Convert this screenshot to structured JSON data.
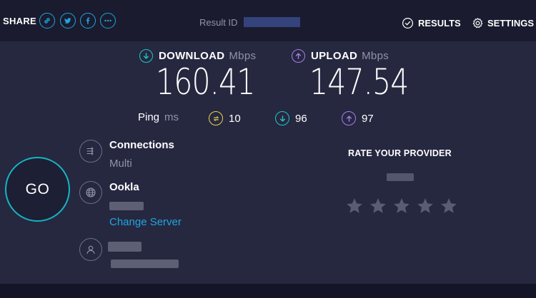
{
  "header": {
    "share_label": "SHARE",
    "share_buttons": [
      {
        "icon": "link-icon",
        "name": "share-link-button"
      },
      {
        "icon": "twitter-icon",
        "name": "share-twitter-button"
      },
      {
        "icon": "facebook-icon",
        "name": "share-facebook-button"
      },
      {
        "icon": "more-icon",
        "name": "share-more-button"
      }
    ],
    "result_id_label": "Result ID",
    "results_label": "RESULTS",
    "settings_label": "SETTINGS"
  },
  "download": {
    "label": "DOWNLOAD",
    "unit": "Mbps",
    "value": "160.41",
    "color": "#1fc7c4"
  },
  "upload": {
    "label": "UPLOAD",
    "unit": "Mbps",
    "value": "147.54",
    "color": "#a97ce8"
  },
  "ping": {
    "label": "Ping",
    "unit": "ms",
    "idle": {
      "value": "10",
      "icon": "ping-idle-icon",
      "color": "#e8d24a"
    },
    "download": {
      "value": "96",
      "icon": "ping-download-icon",
      "color": "#1fc7c4"
    },
    "upload": {
      "value": "97",
      "icon": "ping-upload-icon",
      "color": "#a97ce8"
    }
  },
  "go_label": "GO",
  "connections": {
    "title": "Connections",
    "value": "Multi",
    "icon": "connections-icon"
  },
  "server": {
    "title": "Ookla",
    "change_label": "Change Server",
    "icon": "globe-icon"
  },
  "user": {
    "icon": "user-icon"
  },
  "rate": {
    "title": "RATE YOUR PROVIDER",
    "stars": 5
  },
  "colors": {
    "accent": "#1fa6e0",
    "go_ring": "#15b5c4",
    "panel": "#262840",
    "background": "#141526"
  }
}
